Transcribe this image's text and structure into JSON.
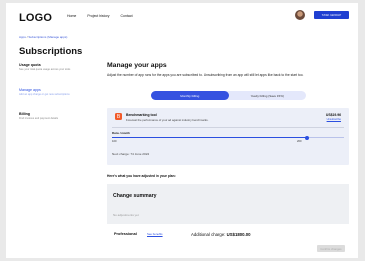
{
  "header": {
    "logo": "LOGO",
    "nav": [
      "Home",
      "Project history",
      "Contact"
    ],
    "upgrade_button": "TASK GROUP"
  },
  "breadcrumb": {
    "root": "Apps",
    "sep": "/",
    "current": "Subscriptions (Manage apps)"
  },
  "page_title": "Subscriptions",
  "sidebar": {
    "items": [
      {
        "label": "Usage quota",
        "desc": "See your total quota usage across your tools"
      },
      {
        "label": "Manage apps",
        "desc": "Add an app charge or get new subscriptions"
      },
      {
        "label": "Billing",
        "desc": "Find invoices and payment details"
      }
    ]
  },
  "main": {
    "title": "Manage your apps",
    "description": "Adjust the number of app runs for the apps you are subscribed to. Unsubscribing from an app will still let apps like back to the start too.",
    "toggle": {
      "monthly": "Monthly billing",
      "yearly": "Yearly billing (Save 15%)",
      "selected": "monthly"
    }
  },
  "app": {
    "icon": "B",
    "icon_color": "#f15a29",
    "name": "Benchmarking tool",
    "description": "Forecast the performance of your ad against industry benchmarks.",
    "price": "US$19.96",
    "unsubscribe": "Unsubscribe",
    "runs_label": "Runs / month",
    "runs_min": "100",
    "runs_max": "200",
    "runs_fill_fraction": 0.84,
    "next_charge": "Next charge: 74 June 2024"
  },
  "adjusted_heading": "Here's what you have adjusted in your plan:",
  "summary": {
    "title": "Change summary",
    "empty": "No adjustments yet"
  },
  "plan": {
    "name": "Professional",
    "link": "See benefits",
    "additional_label": "Additional charge:",
    "additional_amount": "US$1800.00"
  },
  "confirm_button": "Confirm changes",
  "colors": {
    "accent": "#2b4fe0",
    "primary_button": "#1f3fd1"
  }
}
